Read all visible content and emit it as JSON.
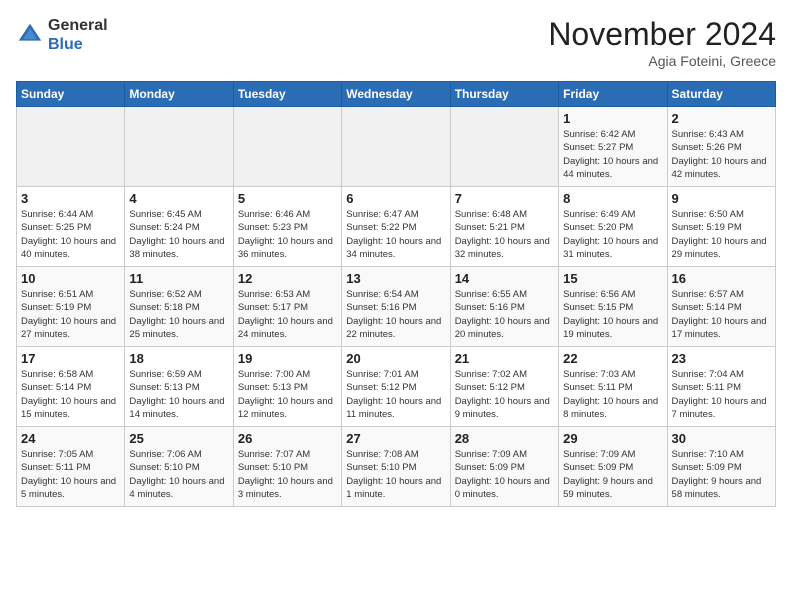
{
  "header": {
    "logo_general": "General",
    "logo_blue": "Blue",
    "month_title": "November 2024",
    "location": "Agia Foteini, Greece"
  },
  "days_of_week": [
    "Sunday",
    "Monday",
    "Tuesday",
    "Wednesday",
    "Thursday",
    "Friday",
    "Saturday"
  ],
  "weeks": [
    [
      {
        "day": "",
        "info": ""
      },
      {
        "day": "",
        "info": ""
      },
      {
        "day": "",
        "info": ""
      },
      {
        "day": "",
        "info": ""
      },
      {
        "day": "",
        "info": ""
      },
      {
        "day": "1",
        "info": "Sunrise: 6:42 AM\nSunset: 5:27 PM\nDaylight: 10 hours and 44 minutes."
      },
      {
        "day": "2",
        "info": "Sunrise: 6:43 AM\nSunset: 5:26 PM\nDaylight: 10 hours and 42 minutes."
      }
    ],
    [
      {
        "day": "3",
        "info": "Sunrise: 6:44 AM\nSunset: 5:25 PM\nDaylight: 10 hours and 40 minutes."
      },
      {
        "day": "4",
        "info": "Sunrise: 6:45 AM\nSunset: 5:24 PM\nDaylight: 10 hours and 38 minutes."
      },
      {
        "day": "5",
        "info": "Sunrise: 6:46 AM\nSunset: 5:23 PM\nDaylight: 10 hours and 36 minutes."
      },
      {
        "day": "6",
        "info": "Sunrise: 6:47 AM\nSunset: 5:22 PM\nDaylight: 10 hours and 34 minutes."
      },
      {
        "day": "7",
        "info": "Sunrise: 6:48 AM\nSunset: 5:21 PM\nDaylight: 10 hours and 32 minutes."
      },
      {
        "day": "8",
        "info": "Sunrise: 6:49 AM\nSunset: 5:20 PM\nDaylight: 10 hours and 31 minutes."
      },
      {
        "day": "9",
        "info": "Sunrise: 6:50 AM\nSunset: 5:19 PM\nDaylight: 10 hours and 29 minutes."
      }
    ],
    [
      {
        "day": "10",
        "info": "Sunrise: 6:51 AM\nSunset: 5:19 PM\nDaylight: 10 hours and 27 minutes."
      },
      {
        "day": "11",
        "info": "Sunrise: 6:52 AM\nSunset: 5:18 PM\nDaylight: 10 hours and 25 minutes."
      },
      {
        "day": "12",
        "info": "Sunrise: 6:53 AM\nSunset: 5:17 PM\nDaylight: 10 hours and 24 minutes."
      },
      {
        "day": "13",
        "info": "Sunrise: 6:54 AM\nSunset: 5:16 PM\nDaylight: 10 hours and 22 minutes."
      },
      {
        "day": "14",
        "info": "Sunrise: 6:55 AM\nSunset: 5:16 PM\nDaylight: 10 hours and 20 minutes."
      },
      {
        "day": "15",
        "info": "Sunrise: 6:56 AM\nSunset: 5:15 PM\nDaylight: 10 hours and 19 minutes."
      },
      {
        "day": "16",
        "info": "Sunrise: 6:57 AM\nSunset: 5:14 PM\nDaylight: 10 hours and 17 minutes."
      }
    ],
    [
      {
        "day": "17",
        "info": "Sunrise: 6:58 AM\nSunset: 5:14 PM\nDaylight: 10 hours and 15 minutes."
      },
      {
        "day": "18",
        "info": "Sunrise: 6:59 AM\nSunset: 5:13 PM\nDaylight: 10 hours and 14 minutes."
      },
      {
        "day": "19",
        "info": "Sunrise: 7:00 AM\nSunset: 5:13 PM\nDaylight: 10 hours and 12 minutes."
      },
      {
        "day": "20",
        "info": "Sunrise: 7:01 AM\nSunset: 5:12 PM\nDaylight: 10 hours and 11 minutes."
      },
      {
        "day": "21",
        "info": "Sunrise: 7:02 AM\nSunset: 5:12 PM\nDaylight: 10 hours and 9 minutes."
      },
      {
        "day": "22",
        "info": "Sunrise: 7:03 AM\nSunset: 5:11 PM\nDaylight: 10 hours and 8 minutes."
      },
      {
        "day": "23",
        "info": "Sunrise: 7:04 AM\nSunset: 5:11 PM\nDaylight: 10 hours and 7 minutes."
      }
    ],
    [
      {
        "day": "24",
        "info": "Sunrise: 7:05 AM\nSunset: 5:11 PM\nDaylight: 10 hours and 5 minutes."
      },
      {
        "day": "25",
        "info": "Sunrise: 7:06 AM\nSunset: 5:10 PM\nDaylight: 10 hours and 4 minutes."
      },
      {
        "day": "26",
        "info": "Sunrise: 7:07 AM\nSunset: 5:10 PM\nDaylight: 10 hours and 3 minutes."
      },
      {
        "day": "27",
        "info": "Sunrise: 7:08 AM\nSunset: 5:10 PM\nDaylight: 10 hours and 1 minute."
      },
      {
        "day": "28",
        "info": "Sunrise: 7:09 AM\nSunset: 5:09 PM\nDaylight: 10 hours and 0 minutes."
      },
      {
        "day": "29",
        "info": "Sunrise: 7:09 AM\nSunset: 5:09 PM\nDaylight: 9 hours and 59 minutes."
      },
      {
        "day": "30",
        "info": "Sunrise: 7:10 AM\nSunset: 5:09 PM\nDaylight: 9 hours and 58 minutes."
      }
    ]
  ]
}
